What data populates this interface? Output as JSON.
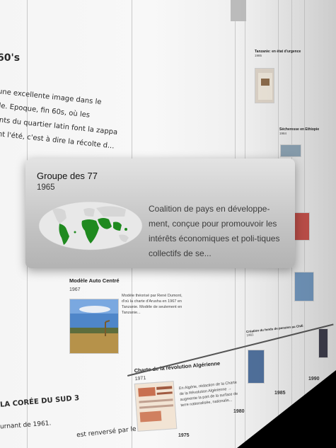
{
  "left_panel": {
    "heading_fragment": "60's",
    "body_lines": [
      "une excellente image dans le",
      "de. Epoque, fin 60s, où les",
      "ants du quartier latin font la zappa",
      "ant l'été, c'est à dire la récolte d..."
    ],
    "coree_heading": "LA CORÉE DU SUD 3",
    "coree_line1": "urnant de 1961.",
    "coree_line2": "est renversé par le"
  },
  "popup": {
    "title": "Groupe des 77",
    "year": "1965",
    "description": "Coalition de pays en développe-ment, conçue pour promouvoir les intérêts économiques et poli-tiques collectifs de se..."
  },
  "events": {
    "auto_centre": {
      "title": "Modèle Auto Centré",
      "year": "1967",
      "desc_lines": [
        "Modèle théorisé par René Dumont,",
        "d'où la charte d'Arusha en 1967 en",
        "Tanzanie. Modèle de seulement en",
        "Tanzanie..."
      ]
    },
    "charte_alg": {
      "title": "Charte de la révolution Algérienne",
      "year": "1971",
      "desc_lines": [
        "En Algérie, rédaction de la Charte",
        "de la Révolution Algérienne →",
        "augmente la part de la surface de",
        "terre nationalisée, nationalis..."
      ]
    },
    "tanzanie": {
      "title": "Tanzanie: en état d'urgence",
      "year": "1985"
    },
    "ethiopie": {
      "title": "Sécheresse en Ethiopie",
      "year": "1984"
    },
    "fonds_pension": {
      "title": "Création du fonds de pension au Chili",
      "year": "1981"
    }
  },
  "axis_years": [
    "1975",
    "1980",
    "1985",
    "1990"
  ],
  "colors": {
    "map_land": "#1f8a1f",
    "map_base": "#e8e8e8",
    "popup_bg": "#c8c8c8"
  }
}
